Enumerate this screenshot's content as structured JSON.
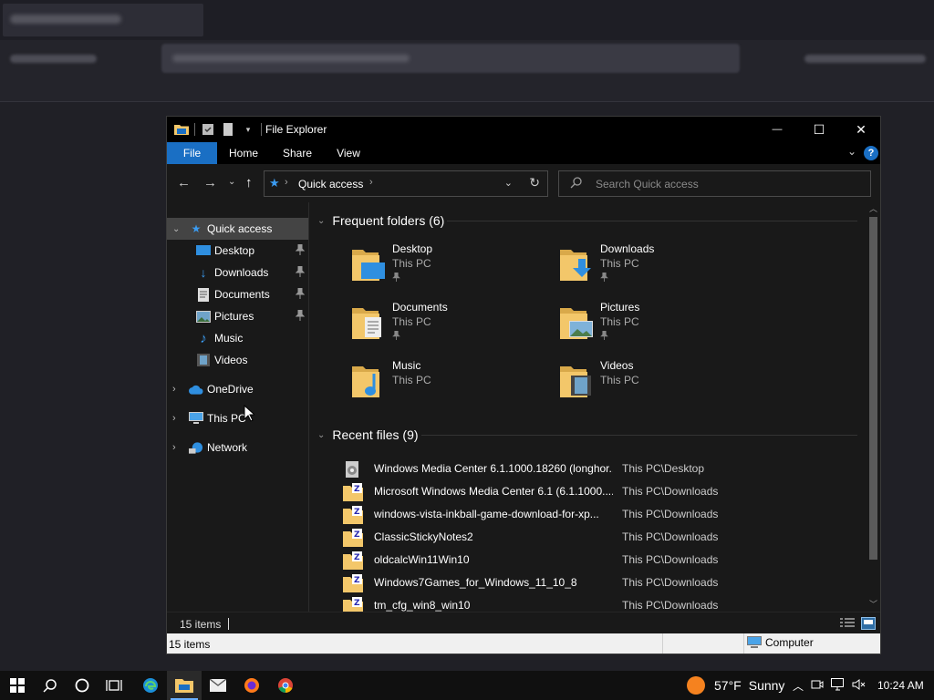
{
  "window": {
    "title": "File Explorer",
    "controls": {
      "minimize": "—",
      "maximize": "☐",
      "close": "✕"
    }
  },
  "ribbon": {
    "tabs": [
      "File",
      "Home",
      "Share",
      "View"
    ],
    "help": "?"
  },
  "address": {
    "breadcrumb": "Quick access",
    "search_placeholder": "Search Quick access"
  },
  "nav_pane": {
    "quick_access": "Quick access",
    "pinned": [
      "Desktop",
      "Downloads",
      "Documents",
      "Pictures"
    ],
    "others": [
      "Music",
      "Videos"
    ],
    "onedrive": "OneDrive",
    "this_pc": "This PC",
    "network": "Network"
  },
  "frequent": {
    "header": "Frequent folders (6)",
    "items": [
      {
        "name": "Desktop",
        "location": "This PC",
        "pinned": true
      },
      {
        "name": "Downloads",
        "location": "This PC",
        "pinned": true
      },
      {
        "name": "Documents",
        "location": "This PC",
        "pinned": true
      },
      {
        "name": "Pictures",
        "location": "This PC",
        "pinned": true
      },
      {
        "name": "Music",
        "location": "This PC",
        "pinned": false
      },
      {
        "name": "Videos",
        "location": "This PC",
        "pinned": false
      }
    ]
  },
  "recent": {
    "header": "Recent files (9)",
    "files": [
      {
        "name": "Windows Media Center 6.1.1000.18260 (longhor...",
        "path": "This PC\\Desktop",
        "icon": "installer-icon"
      },
      {
        "name": "Microsoft Windows Media Center 6.1 (6.1.1000....",
        "path": "This PC\\Downloads",
        "icon": "zip-folder-icon"
      },
      {
        "name": "windows-vista-inkball-game-download-for-xp...",
        "path": "This PC\\Downloads",
        "icon": "zip-folder-icon"
      },
      {
        "name": "ClassicStickyNotes2",
        "path": "This PC\\Downloads",
        "icon": "zip-folder-icon"
      },
      {
        "name": "oldcalcWin11Win10",
        "path": "This PC\\Downloads",
        "icon": "zip-folder-icon"
      },
      {
        "name": "Windows7Games_for_Windows_11_10_8",
        "path": "This PC\\Downloads",
        "icon": "zip-folder-icon"
      },
      {
        "name": "tm_cfg_win8_win10",
        "path": "This PC\\Downloads",
        "icon": "zip-folder-icon"
      }
    ]
  },
  "status": {
    "inner_count": "15 items",
    "outer_count": "15 items",
    "computer": "Computer"
  },
  "taskbar": {
    "weather_temp": "57°F",
    "weather_cond": "Sunny",
    "time": "10:24 AM"
  },
  "colors": {
    "accent": "#1a6fc4",
    "folder": "#f3c76a",
    "selection": "#444444"
  }
}
